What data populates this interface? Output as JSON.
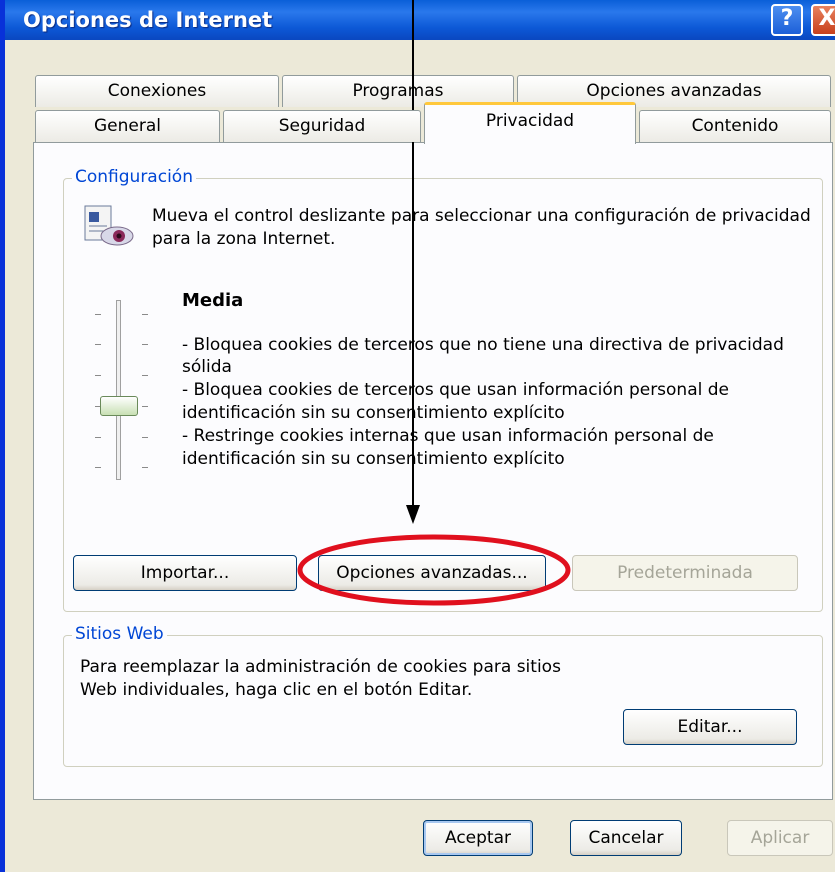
{
  "window": {
    "title": "Opciones de Internet"
  },
  "titlebar": {
    "help_glyph": "?",
    "close_glyph": "X"
  },
  "tabs_back": [
    "Conexiones",
    "Programas",
    "Opciones avanzadas"
  ],
  "tabs_front": [
    "General",
    "Seguridad",
    "Privacidad",
    "Contenido"
  ],
  "active_tab": "Privacidad",
  "config": {
    "label": "Configuración",
    "description": [
      "Mueva el control deslizante para seleccionar una configuración de privacidad",
      "para la zona Internet."
    ],
    "level_title": "Media",
    "level_lines": [
      "- Bloquea cookies de terceros que no tiene una directiva de privacidad",
      "sólida",
      "- Bloquea cookies de terceros que usan información personal de",
      "identificación sin su consentimiento explícito",
      "- Restringe cookies internas que usan información personal de",
      "identificación sin su consentimiento explícito"
    ],
    "import_label": "Importar...",
    "advanced_label": "Opciones avanzadas...",
    "default_label": "Predeterminada"
  },
  "sites": {
    "label": "Sitios Web",
    "description": [
      "Para reemplazar la administración de cookies para sitios",
      "Web individuales, haga clic en el botón Editar."
    ],
    "edit_label": "Editar..."
  },
  "footer": {
    "ok_label": "Aceptar",
    "cancel_label": "Cancelar",
    "apply_label": "Aplicar"
  },
  "annotation_color": "#e0101e"
}
